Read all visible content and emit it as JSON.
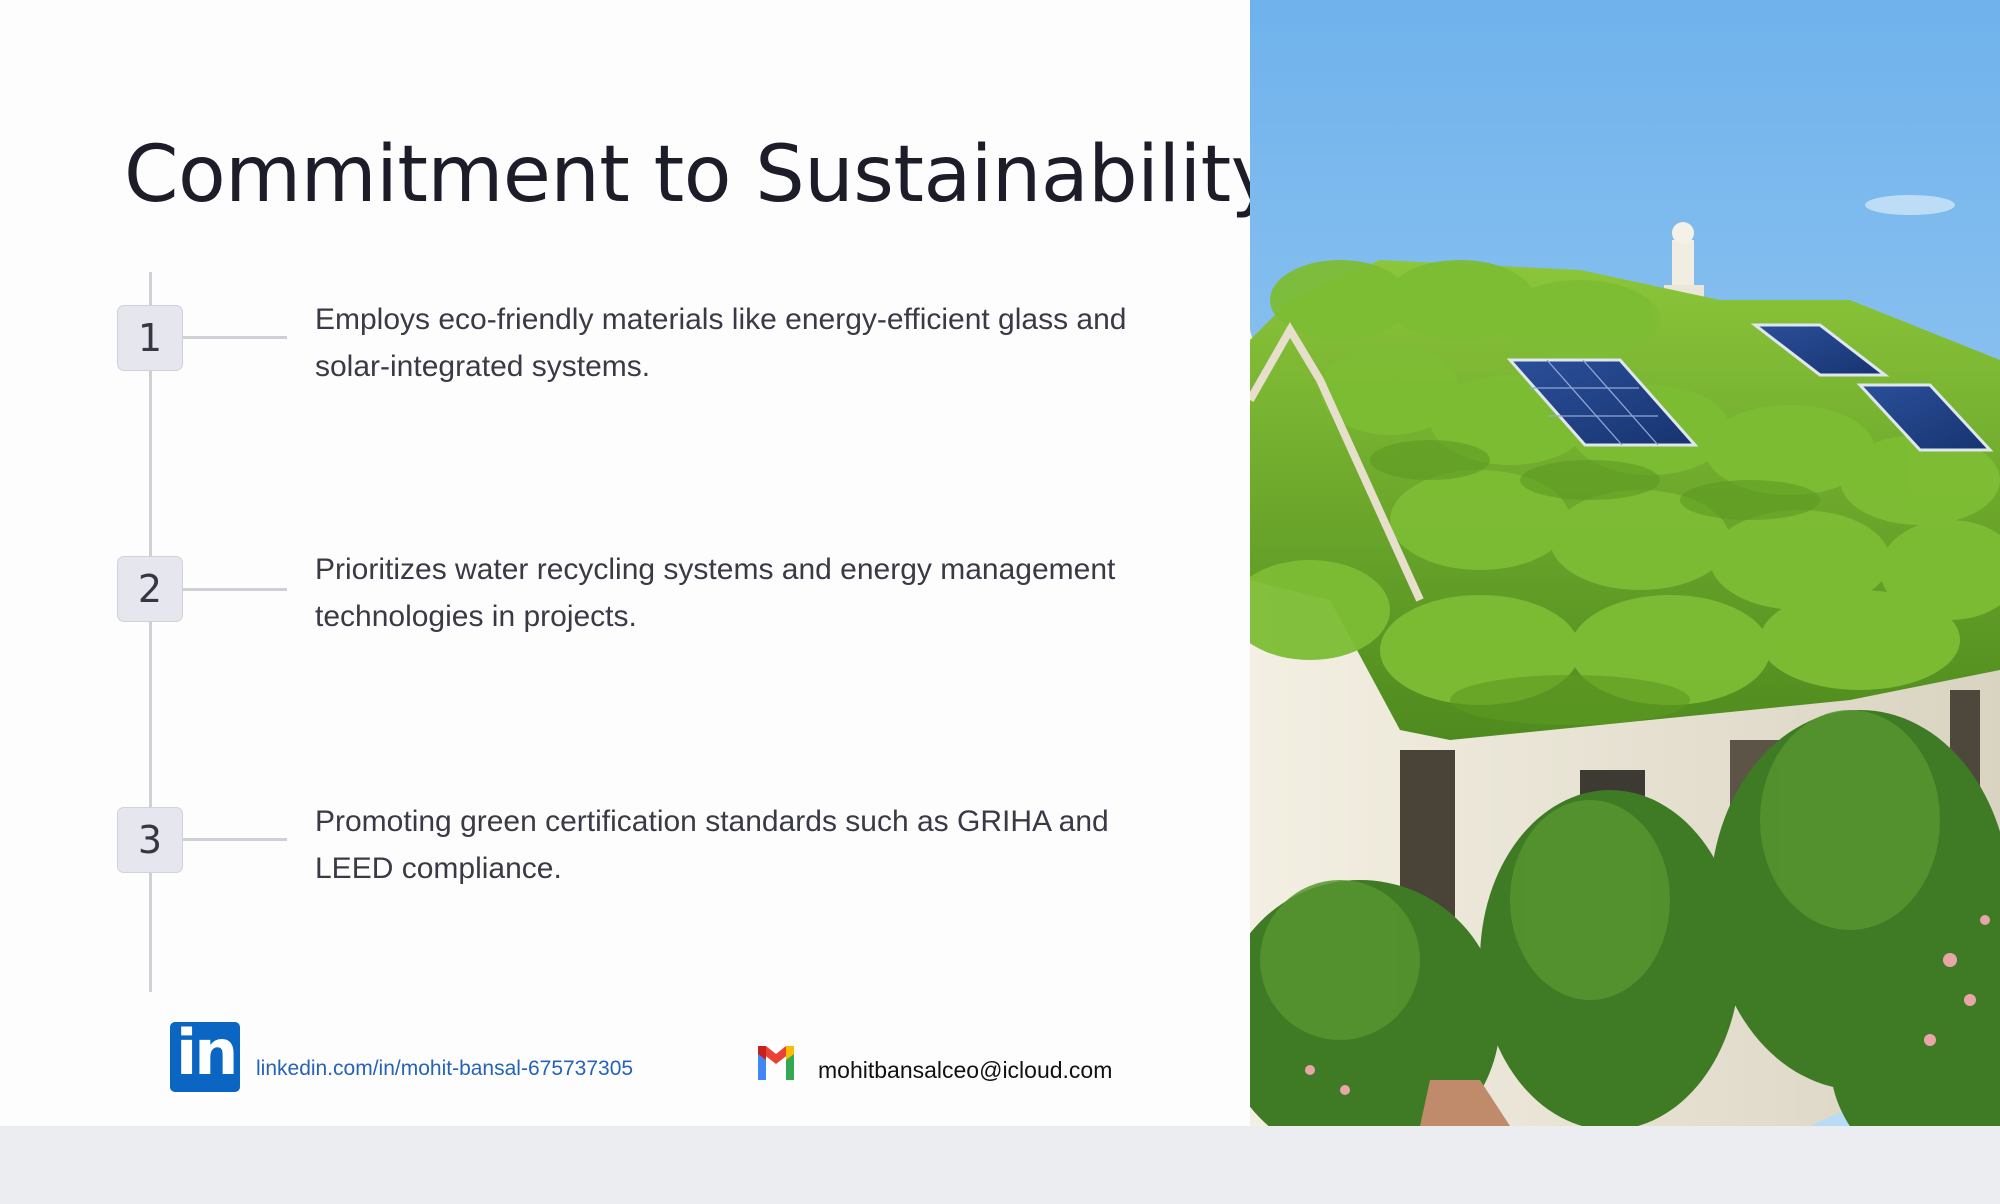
{
  "title": "Commitment to Sustainability",
  "steps": [
    {
      "number": "1",
      "text": "Employs eco-friendly materials like energy-efficient glass and solar-integrated systems."
    },
    {
      "number": "2",
      "text": "Prioritizes water recycling systems and energy management technologies in projects."
    },
    {
      "number": "3",
      "text": "Promoting green certification standards such as GRIHA and LEED compliance."
    }
  ],
  "footer": {
    "linkedin_logo_text": "in",
    "linkedin_url": "linkedin.com/in/mohit-bansal-675737305",
    "email": "mohitbansalceo@icloud.com"
  },
  "colors": {
    "linkedin_blue": "#0a66c2",
    "link_text": "#2563b6",
    "sky": "#7ab8ec",
    "grass": "#6ea82c"
  },
  "icons": [
    "linkedin-icon",
    "gmail-icon"
  ]
}
